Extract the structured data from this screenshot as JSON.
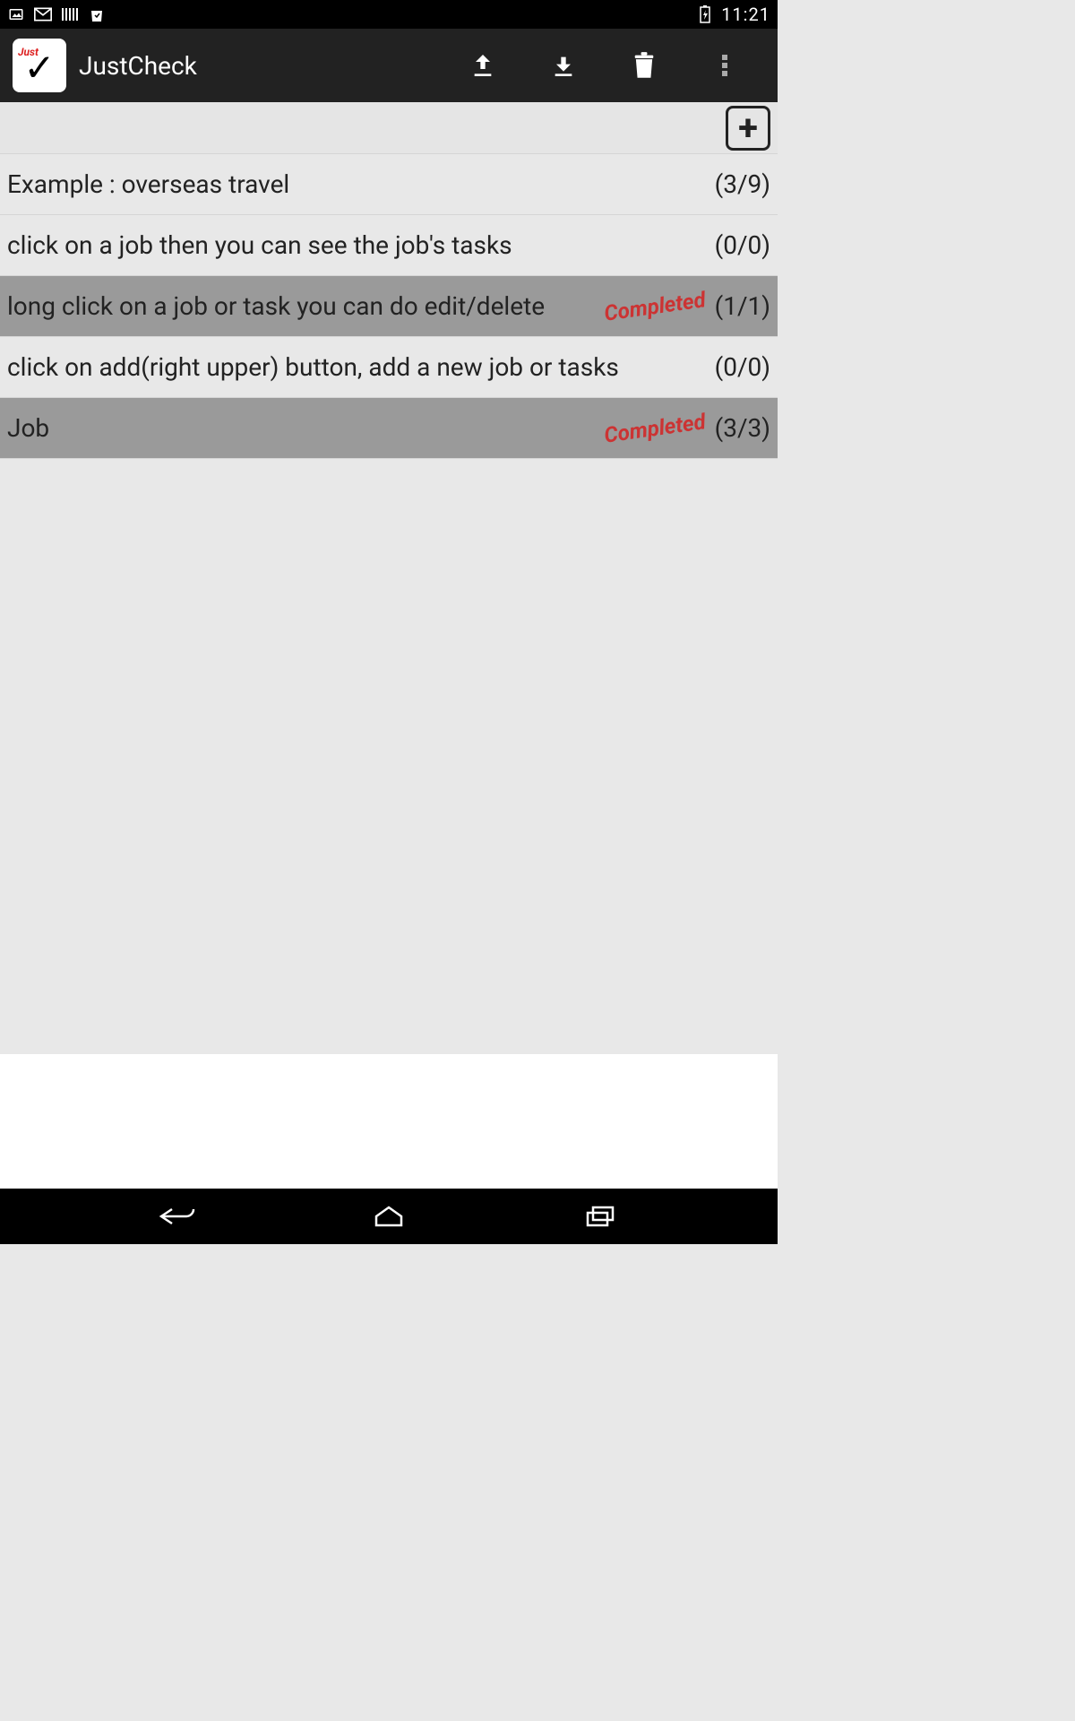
{
  "status_bar": {
    "time": "11:21"
  },
  "action_bar": {
    "title": "JustCheck",
    "app_icon_tag": "Just"
  },
  "jobs": [
    {
      "title": "Example : overseas travel",
      "count": "(3/9)",
      "completed": false
    },
    {
      "title": "click on a job then you can see the job's tasks",
      "count": "(0/0)",
      "completed": false
    },
    {
      "title": "long click on a job or task you can do edit/delete",
      "count": "(1/1)",
      "completed": true
    },
    {
      "title": "click on add(right upper) button, add a new job or tasks",
      "count": "(0/0)",
      "completed": false
    },
    {
      "title": "Job",
      "count": "(3/3)",
      "completed": true
    }
  ],
  "labels": {
    "completed_stamp": "Completed"
  }
}
